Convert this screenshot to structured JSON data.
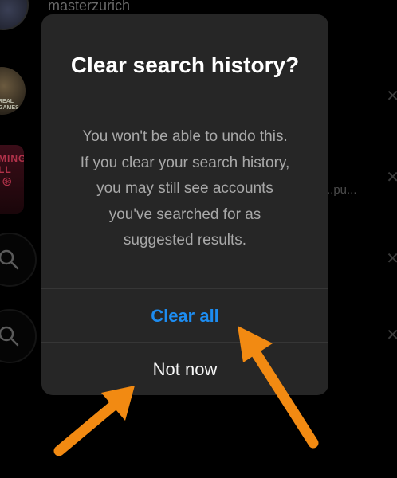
{
  "background": {
    "username": "masterzurich",
    "truncated_text": "..pu...",
    "avatar2_label": "REAL GAMES",
    "avatar3_label": "MING LL"
  },
  "dialog": {
    "title": "Clear search history?",
    "message": "You won't be able to undo this. If you clear your search history, you may still see accounts you've searched for as suggested results.",
    "primary_button": "Clear all",
    "secondary_button": "Not now"
  },
  "colors": {
    "dialog_bg": "#262626",
    "primary_blue": "#1d8cf0",
    "arrow_orange": "#f28a12"
  },
  "icons": {
    "search": "search-icon",
    "close": "close-icon",
    "arrow": "annotation-arrow"
  }
}
